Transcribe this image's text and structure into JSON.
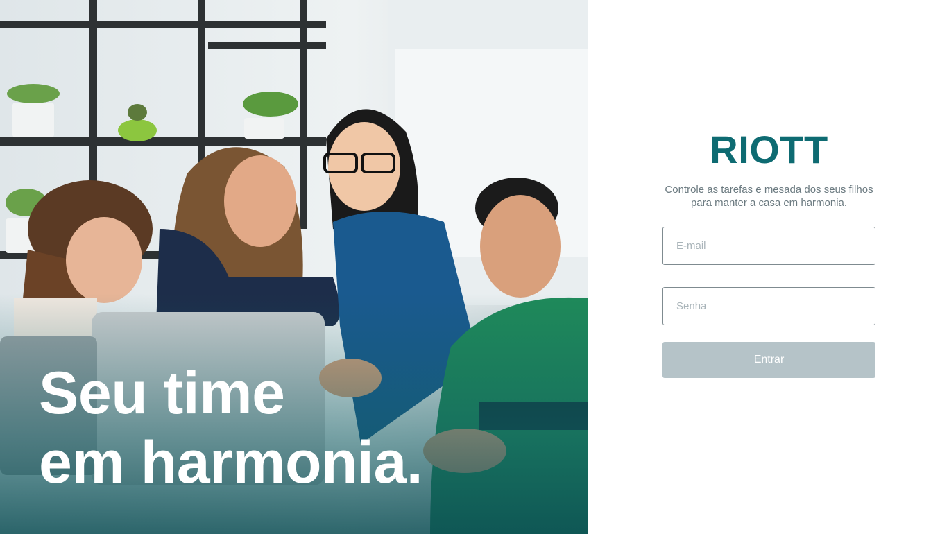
{
  "hero": {
    "title_line1": "Seu time",
    "title_line2": "em harmonia."
  },
  "login": {
    "brand": "RIOTT",
    "tagline": "Controle as tarefas e mesada dos seus filhos para manter a casa em harmonia.",
    "email": {
      "placeholder": "E-mail",
      "value": ""
    },
    "password": {
      "placeholder": "Senha",
      "value": ""
    },
    "submit_label": "Entrar"
  },
  "colors": {
    "brand": "#0e6b72",
    "button_disabled": "#b5c3c8",
    "input_border": "#7f8b90",
    "hero_overlay": "#0c4e54"
  }
}
